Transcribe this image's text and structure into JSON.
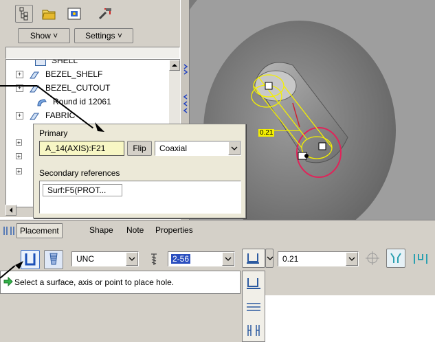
{
  "toolbar_top": {
    "icons": [
      "model-tree-icon",
      "folder-icon",
      "layer-icon",
      "tools-icon"
    ],
    "show_label": "Show ˅",
    "settings_label": "Settings ˅"
  },
  "tree": {
    "items": [
      {
        "label": "SHELL",
        "icon": "shell-icon"
      },
      {
        "label": "BEZEL_SHELF",
        "icon": "feature-icon"
      },
      {
        "label": "BEZEL_CUTOUT",
        "icon": "feature-icon"
      },
      {
        "label": "Round id 12061",
        "icon": "round-icon"
      },
      {
        "label": "FABRIC",
        "icon": "feature-icon"
      }
    ]
  },
  "placement_popup": {
    "primary_label": "Primary",
    "primary_value": "A_14(AXIS):F21",
    "flip_label": "Flip",
    "coaxial_value": "Coaxial",
    "secondary_label": "Secondary references",
    "secondary_value": "Surf:F5(PROT..."
  },
  "dashboard": {
    "tabs": [
      "Placement",
      "Shape",
      "Note",
      "Properties"
    ],
    "thread_standard": "UNC",
    "screw_size": "2-56",
    "depth_value": "0.21",
    "status_message": "Select a surface, axis or point to place hole."
  },
  "graphics": {
    "dimension_label": "0.21"
  }
}
